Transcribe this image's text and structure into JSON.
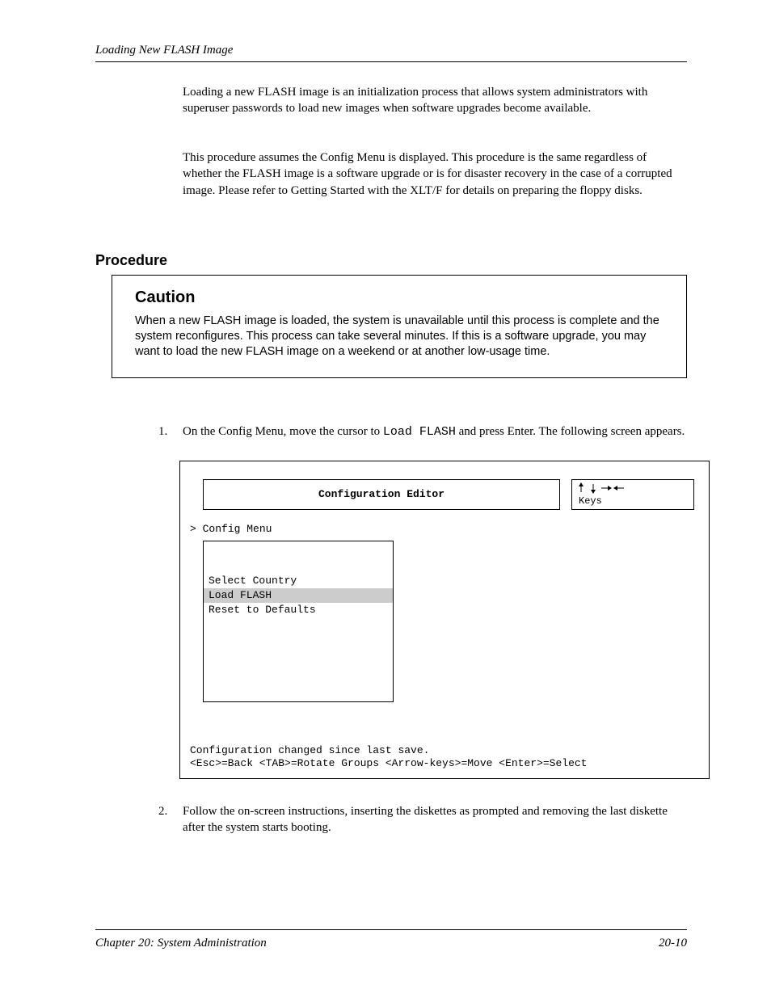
{
  "header": {
    "title": "Loading New FLASH Image"
  },
  "body": {
    "para1": "Loading a new FLASH image is an initialization process that allows system administrators with superuser passwords to load new images when software upgrades become available.",
    "para2": "This procedure assumes the Config Menu is displayed. This procedure is the same regardless of whether the FLASH image is a software upgrade or is for disaster recovery in the case of a corrupted image. Please refer to Getting Started with the XLT/F for details on preparing the floppy disks."
  },
  "section_heading": "Procedure",
  "caution": {
    "word": "Caution",
    "text": "When a new FLASH image is loaded, the system is unavailable until this process is complete and the system reconfigures. This process can take several minutes. If this is a software upgrade, you may want to load the new FLASH image on a weekend or at another low-usage time."
  },
  "steps": {
    "s1_num": "1.",
    "s1_a": "On the Config Menu, move the cursor to",
    "s1_cmd": "Load FLASH",
    "s1_b": "and press Enter. The following screen appears.",
    "s2_num": "2.",
    "s2_text": "Follow the on-screen instructions, inserting the diskettes as prompted and removing the last diskette after the system starts booting."
  },
  "config": {
    "title": "Configuration Editor",
    "arrow_label": "Keys",
    "menu_header": "Config Menu",
    "items": [
      "Select Country",
      "Load FLASH",
      "Reset to Defaults"
    ],
    "footer_status": "Configuration changed since last save.",
    "footer_keys": "<Esc>=Back  <TAB>=Rotate Groups  <Arrow-keys>=Move  <Enter>=Select"
  },
  "footer": {
    "left": "Chapter 20: System Administration",
    "right": "20-10"
  }
}
